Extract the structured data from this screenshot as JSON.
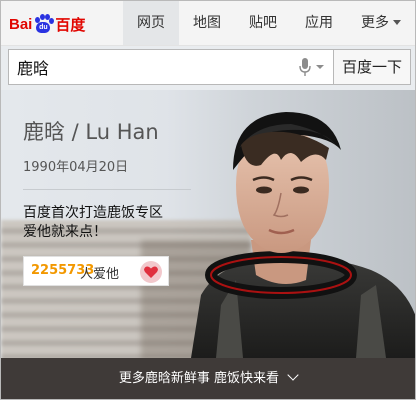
{
  "logo": {
    "prefix": "Bai",
    "badge": "du",
    "suffix": "百度"
  },
  "nav": {
    "tabs": [
      {
        "label": "网页",
        "active": true
      },
      {
        "label": "地图",
        "active": false
      },
      {
        "label": "贴吧",
        "active": false
      },
      {
        "label": "应用",
        "active": false
      },
      {
        "label": "更多",
        "active": false
      }
    ]
  },
  "search": {
    "value": "鹿晗",
    "button_label": "百度一下"
  },
  "profile": {
    "name": "鹿晗 / Lu Han",
    "birthdate": "1990年04月20日",
    "description_line1": "百度首次打造鹿饭专区",
    "description_line2": "爱他就来点！",
    "like_count": "2255733",
    "like_label": "人爱他"
  },
  "bottom_bar": {
    "label": "更多鹿晗新鲜事 鹿饭快来看"
  },
  "colors": {
    "brand_red": "#e10601",
    "brand_blue": "#2932e1",
    "like_orange": "#f29800",
    "heart_red": "#e0303f"
  }
}
